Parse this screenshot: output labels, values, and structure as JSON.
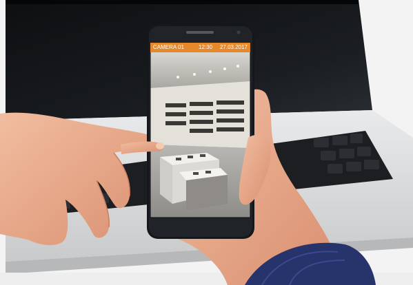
{
  "camera_view": {
    "camera_name": "CAMERA 01",
    "time": "12:30",
    "date": "27.03.2017"
  },
  "colors": {
    "status_bar": "#e6892c",
    "laptop_body": "#d9dadb",
    "screen": "#111315",
    "keyboard": "#1d1f22",
    "skin": "#e7a888",
    "sleeve": "#27336b"
  }
}
